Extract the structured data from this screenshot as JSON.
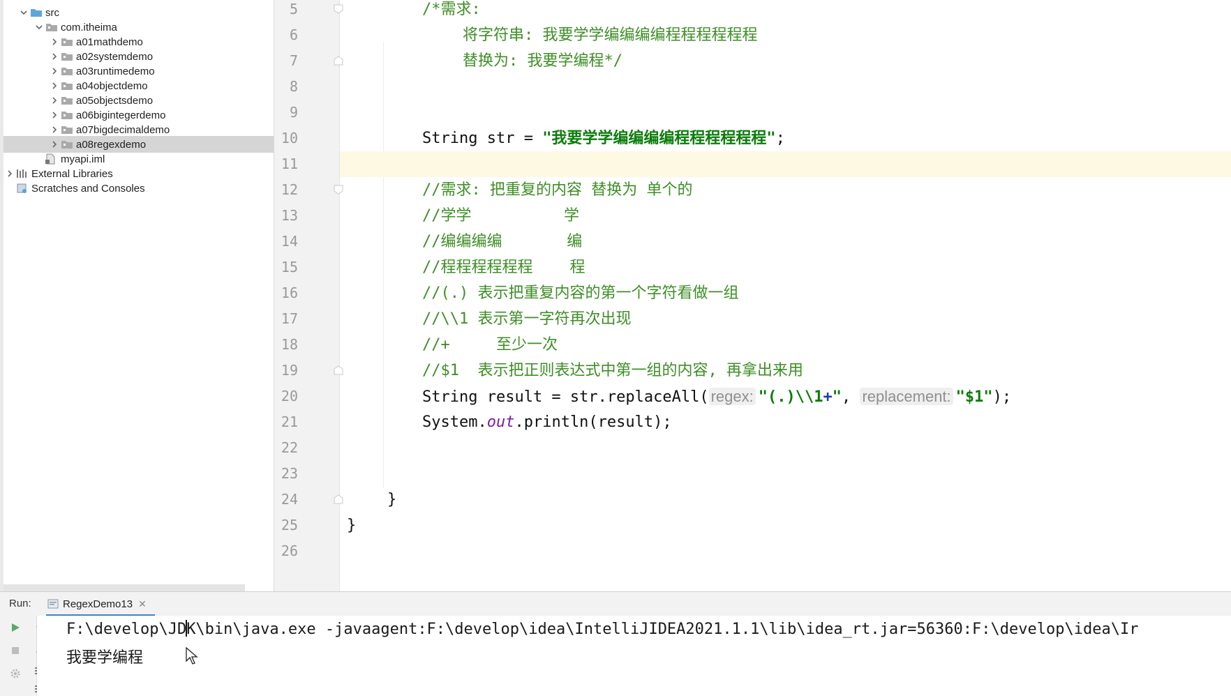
{
  "project_tree": {
    "items": [
      {
        "label": "src",
        "level": 0,
        "expanded": true,
        "icon": "source-folder-icon"
      },
      {
        "label": "com.itheima",
        "level": 1,
        "expanded": true,
        "icon": "package-icon"
      },
      {
        "label": "a01mathdemo",
        "level": 2,
        "expanded": false,
        "icon": "package-icon"
      },
      {
        "label": "a02systemdemo",
        "level": 2,
        "expanded": false,
        "icon": "package-icon"
      },
      {
        "label": "a03runtimedemo",
        "level": 2,
        "expanded": false,
        "icon": "package-icon"
      },
      {
        "label": "a04objectdemo",
        "level": 2,
        "expanded": false,
        "icon": "package-icon"
      },
      {
        "label": "a05objectsdemo",
        "level": 2,
        "expanded": false,
        "icon": "package-icon"
      },
      {
        "label": "a06bigintegerdemo",
        "level": 2,
        "expanded": false,
        "icon": "package-icon"
      },
      {
        "label": "a07bigdecimaldemo",
        "level": 2,
        "expanded": false,
        "icon": "package-icon"
      },
      {
        "label": "a08regexdemo",
        "level": 2,
        "expanded": false,
        "selected": true,
        "icon": "package-icon"
      },
      {
        "label": "myapi.iml",
        "level": 1,
        "icon": "iml-file-icon"
      },
      {
        "label": "External Libraries",
        "level": -1,
        "expanded": false,
        "icon": "libraries-icon"
      },
      {
        "label": "Scratches and Consoles",
        "level": -1,
        "icon": "scratches-icon"
      }
    ]
  },
  "editor": {
    "current_line": "11",
    "line_numbers": [
      "5",
      "6",
      "7",
      "8",
      "9",
      "10",
      "11",
      "12",
      "13",
      "14",
      "15",
      "16",
      "17",
      "18",
      "19",
      "20",
      "21",
      "22",
      "23",
      "24",
      "25",
      "26"
    ],
    "lines": {
      "l5": "/*需求:",
      "l6": "将字符串: 我要学学编编编编程程程程程程",
      "l7": "替换为: 我要学编程*/",
      "l10_kw": "String str = ",
      "l10_str": "\"我要学学编编编编程程程程程程\"",
      "l10_end": ";",
      "l12": "//需求: 把重复的内容 替换为 单个的",
      "l13": "//学学          学",
      "l14": "//编编编编       编",
      "l15": "//程程程程程程    程",
      "l16": "//(.) 表示把重复内容的第一个字符看做一组",
      "l17": "//\\\\1 表示第一字符再次出现",
      "l18": "//+     至少一次",
      "l19": "//$1  表示把正则表达式中第一组的内容, 再拿出来用",
      "l20_a": "String result = str.replaceAll(",
      "l20_hint1": "regex:",
      "l20_str1a": "\"(.)\\\\1",
      "l20_plus": "+",
      "l20_str1b": "\"",
      "l20_comma": ", ",
      "l20_hint2": "replacement:",
      "l20_str2": "\"$1\"",
      "l20_end": ");",
      "l21_a": "System.",
      "l21_out": "out",
      "l21_b": ".println(result);",
      "l24": "}",
      "l25": "}"
    }
  },
  "run_panel": {
    "label": "Run:",
    "tab_label": "RegexDemo13",
    "console": {
      "command_before_caret": "F:\\develop\\JD",
      "command_after_caret": "K\\bin\\java.exe -javaagent:F:\\develop\\idea\\IntelliJIDEA2021.1.1\\lib\\idea_rt.jar=56360:F:\\develop\\idea\\Ir",
      "output": "我要学编程"
    }
  },
  "colors": {
    "comment": "#3e8e26",
    "string": "#0a7d0a",
    "static_field": "#7a1ea1",
    "current_line": "#fdf9e3",
    "selected_row": "#d5d5d5",
    "run_tab_underline": "#4083c9"
  }
}
